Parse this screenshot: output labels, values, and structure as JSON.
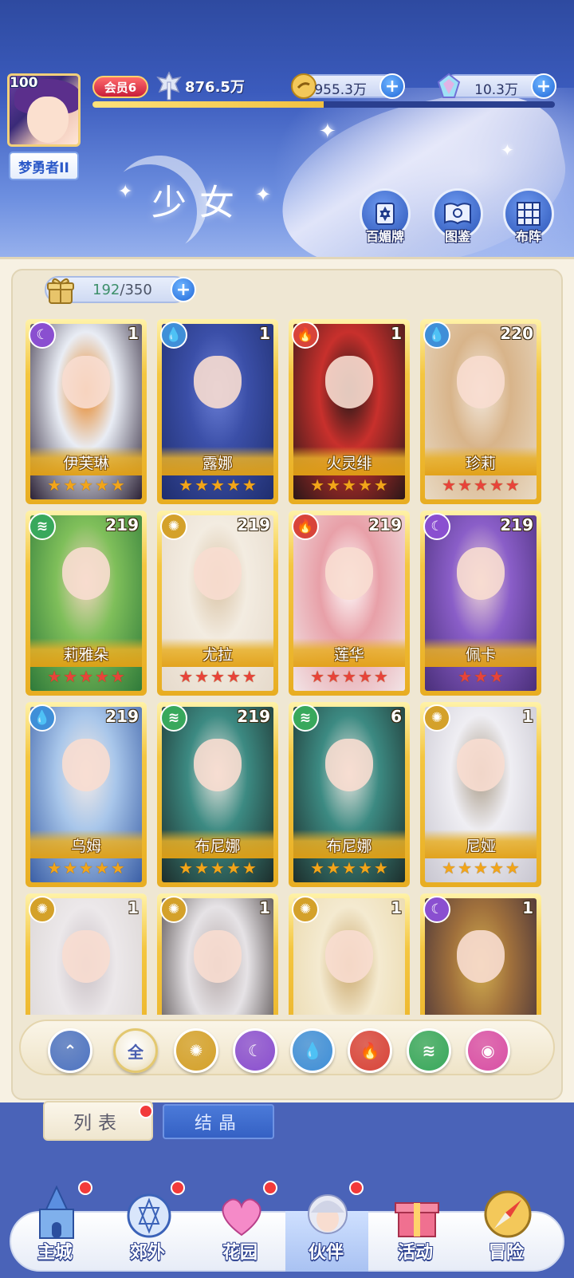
{
  "player": {
    "level": "100",
    "title": "梦勇者II",
    "vip": "会员6",
    "power": "876.5万",
    "exp_progress": 0.5
  },
  "currencies": [
    {
      "name": "gold-coin",
      "value": "955.3万",
      "color": "#e9b84a"
    },
    {
      "name": "diamond",
      "value": "10.3万",
      "color": "#7fd0f0"
    }
  ],
  "header": {
    "section_title": "少女",
    "buttons": [
      {
        "label": "百媚牌",
        "icon": "card-deck-icon"
      },
      {
        "label": "图鉴",
        "icon": "book-icon"
      },
      {
        "label": "布阵",
        "icon": "grid-formation-icon"
      }
    ]
  },
  "capacity": {
    "current": "192",
    "separator": "/",
    "max": "350"
  },
  "elements": {
    "moon": {
      "color": "#8a4fd0",
      "glyph": "☾"
    },
    "water": {
      "color": "#3f8fd8",
      "glyph": "💧"
    },
    "fire": {
      "color": "#d8443a",
      "glyph": "🔥"
    },
    "wind": {
      "color": "#38a85c",
      "glyph": "≋"
    },
    "light": {
      "color": "#d4a12a",
      "glyph": "✺"
    },
    "star": {
      "color": "#d94fa6",
      "glyph": "◉"
    }
  },
  "cards": [
    {
      "name": "伊芙琳",
      "level": "1",
      "element": "moon",
      "stars": 5,
      "star_color": "#f2a51a",
      "art": [
        "#2b2135",
        "#e9edf5",
        "#e6821f"
      ]
    },
    {
      "name": "露娜",
      "level": "1",
      "element": "water",
      "stars": 5,
      "star_color": "#f2a51a",
      "art": [
        "#1f2e6e",
        "#3b4fa8",
        "#6b7fd6"
      ]
    },
    {
      "name": "火灵绯",
      "level": "1",
      "element": "fire",
      "stars": 5,
      "star_color": "#f2a51a",
      "art": [
        "#2a1718",
        "#c8302c",
        "#1c1616"
      ]
    },
    {
      "name": "珍莉",
      "level": "220",
      "element": "water",
      "stars": 5,
      "star_color": "#e8433a",
      "art": [
        "#e8d9c3",
        "#d8b48a",
        "#f3e9de"
      ]
    },
    {
      "name": "莉雅朵",
      "level": "219",
      "element": "wind",
      "stars": 5,
      "star_color": "#e8433a",
      "art": [
        "#2f7a3a",
        "#7fbf5a",
        "#f2d6c0"
      ]
    },
    {
      "name": "尤拉",
      "level": "219",
      "element": "light",
      "stars": 5,
      "star_color": "#e8433a",
      "art": [
        "#e6dacb",
        "#f3ece1",
        "#d9c3a5"
      ]
    },
    {
      "name": "莲华",
      "level": "219",
      "element": "fire",
      "stars": 5,
      "star_color": "#e8433a",
      "art": [
        "#f1e4e6",
        "#e8a0a8",
        "#ffffff"
      ]
    },
    {
      "name": "佩卡",
      "level": "219",
      "element": "moon",
      "stars": 3,
      "star_color": "#e8433a",
      "art": [
        "#4a2f7a",
        "#8a5ec8",
        "#f0d8d8"
      ]
    },
    {
      "name": "乌姆",
      "level": "219",
      "element": "water",
      "stars": 5,
      "star_color": "#f2a51a",
      "art": [
        "#3b5fa6",
        "#a8c6ea",
        "#f4ebe6"
      ]
    },
    {
      "name": "布尼娜",
      "level": "219",
      "element": "wind",
      "stars": 5,
      "star_color": "#f2a51a",
      "art": [
        "#1d2e2c",
        "#3c8a82",
        "#e9e6e0"
      ]
    },
    {
      "name": "布尼娜",
      "level": "6",
      "element": "wind",
      "stars": 5,
      "star_color": "#f2a51a",
      "art": [
        "#1d2e2c",
        "#3c8a82",
        "#e9e6e0"
      ]
    },
    {
      "name": "尼娅",
      "level": "1",
      "element": "light",
      "stars": 5,
      "star_color": "#f2a51a",
      "art": [
        "#c8c6d0",
        "#efeef3",
        "#a89a86"
      ]
    },
    {
      "name": "",
      "level": "1",
      "element": "light",
      "stars": 0,
      "star_color": "#f2a51a",
      "art": [
        "#d9d4d2",
        "#ece8ea",
        "#c8bfc4"
      ]
    },
    {
      "name": "",
      "level": "1",
      "element": "light",
      "stars": 0,
      "star_color": "#f2a51a",
      "art": [
        "#3a3232",
        "#e6e3e6",
        "#b4a8a8"
      ]
    },
    {
      "name": "",
      "level": "1",
      "element": "light",
      "stars": 0,
      "star_color": "#f2a51a",
      "art": [
        "#e9d7a8",
        "#f4ead0",
        "#c9a66a"
      ]
    },
    {
      "name": "",
      "level": "1",
      "element": "moon",
      "stars": 0,
      "star_color": "#f2a51a",
      "art": [
        "#3a2a3a",
        "#a0703c",
        "#d4b050"
      ]
    }
  ],
  "filters": [
    {
      "id": "up",
      "label": "",
      "color": "#4e74c2",
      "glyph": "⌃"
    },
    {
      "id": "all",
      "label": "全",
      "color": "#f3ecd9",
      "glyph": ""
    },
    {
      "id": "light",
      "label": "",
      "color": "#d4a12a",
      "glyph": "✺"
    },
    {
      "id": "moon",
      "label": "",
      "color": "#8a4fd0",
      "glyph": "☾"
    },
    {
      "id": "water",
      "label": "",
      "color": "#3f8fd8",
      "glyph": "💧"
    },
    {
      "id": "fire",
      "label": "",
      "color": "#d8443a",
      "glyph": "🔥"
    },
    {
      "id": "wind",
      "label": "",
      "color": "#38a85c",
      "glyph": "≋"
    },
    {
      "id": "star",
      "label": "",
      "color": "#d94fa6",
      "glyph": "◉"
    }
  ],
  "tabs": {
    "list": "列表",
    "crystal": "结晶"
  },
  "nav": [
    {
      "label": "主城",
      "icon": "castle-icon",
      "badge": true
    },
    {
      "label": "郊外",
      "icon": "magic-circle-icon",
      "badge": true
    },
    {
      "label": "花园",
      "icon": "heart-icon",
      "badge": true
    },
    {
      "label": "伙伴",
      "icon": "companion-icon",
      "badge": true,
      "active": true
    },
    {
      "label": "活动",
      "icon": "gift-icon",
      "badge": false
    },
    {
      "label": "冒险",
      "icon": "compass-icon",
      "badge": false
    }
  ]
}
